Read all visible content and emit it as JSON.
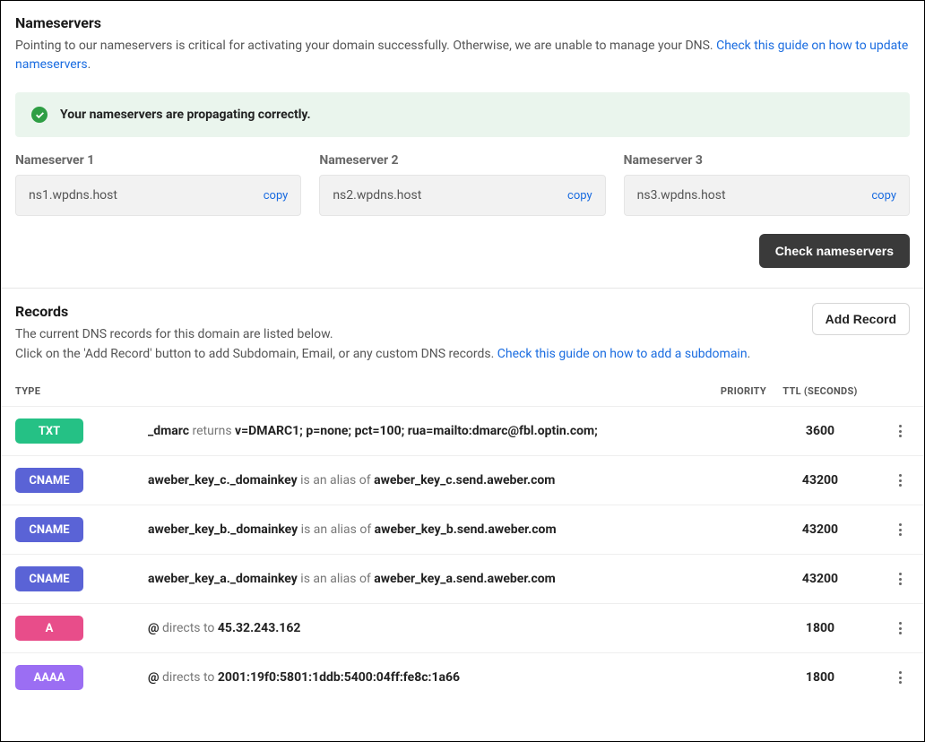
{
  "nameservers": {
    "title": "Nameservers",
    "desc_prefix": "Pointing to our nameservers is critical for activating your domain successfully. Otherwise, we are unable to manage your DNS. ",
    "guide_link": "Check this guide on how to update nameservers",
    "alert": "Your nameservers are propagating correctly.",
    "servers": [
      {
        "label": "Nameserver 1",
        "value": "ns1.wpdns.host",
        "copy": "copy"
      },
      {
        "label": "Nameserver 2",
        "value": "ns2.wpdns.host",
        "copy": "copy"
      },
      {
        "label": "Nameserver 3",
        "value": "ns3.wpdns.host",
        "copy": "copy"
      }
    ],
    "check_btn": "Check nameservers"
  },
  "records": {
    "title": "Records",
    "line1": "The current DNS records for this domain are listed below.",
    "line2_prefix": "Click on the 'Add Record' button to add Subdomain, Email, or any custom DNS records. ",
    "guide_link": "Check this guide on how to add a subdomain",
    "add_btn": "Add Record",
    "headers": {
      "type": "TYPE",
      "priority": "PRIORITY",
      "ttl": "TTL (SECONDS)"
    },
    "rows": [
      {
        "badge": "TXT",
        "badge_class": "badge-txt",
        "name": "_dmarc",
        "verb": " returns ",
        "value": "v=DMARC1; p=none; pct=100; rua=mailto:dmarc@fbl.optin.com;",
        "ttl": "3600"
      },
      {
        "badge": "CNAME",
        "badge_class": "badge-cname",
        "name": "aweber_key_c._domainkey",
        "verb": " is an alias of ",
        "value": "aweber_key_c.send.aweber.com",
        "ttl": "43200"
      },
      {
        "badge": "CNAME",
        "badge_class": "badge-cname",
        "name": "aweber_key_b._domainkey",
        "verb": " is an alias of ",
        "value": "aweber_key_b.send.aweber.com",
        "ttl": "43200"
      },
      {
        "badge": "CNAME",
        "badge_class": "badge-cname",
        "name": "aweber_key_a._domainkey",
        "verb": " is an alias of ",
        "value": "aweber_key_a.send.aweber.com",
        "ttl": "43200"
      },
      {
        "badge": "A",
        "badge_class": "badge-a",
        "name": "@",
        "verb": " directs to ",
        "value": "45.32.243.162",
        "ttl": "1800"
      },
      {
        "badge": "AAAA",
        "badge_class": "badge-aaaa",
        "name": "@",
        "verb": " directs to ",
        "value": "2001:19f0:5801:1ddb:5400:04ff:fe8c:1a66",
        "ttl": "1800"
      }
    ]
  },
  "suffix": "."
}
